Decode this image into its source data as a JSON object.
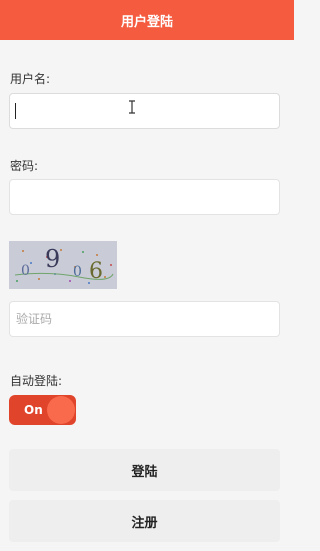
{
  "header": {
    "title": "用户登陆"
  },
  "form": {
    "username_label": "用户名:",
    "username_value": "",
    "password_label": "密码:",
    "password_value": "",
    "captcha_chars": [
      "0",
      "9",
      "0",
      "6"
    ],
    "captcha_placeholder": "验证码",
    "auto_login_label": "自动登陆:",
    "auto_login_toggle": "On",
    "auto_login_on": true
  },
  "buttons": {
    "login": "登陆",
    "register": "注册"
  },
  "colors": {
    "header_bg": "#f45b3f",
    "toggle_bg": "#e0452c",
    "button_bg": "#eeeeee"
  }
}
